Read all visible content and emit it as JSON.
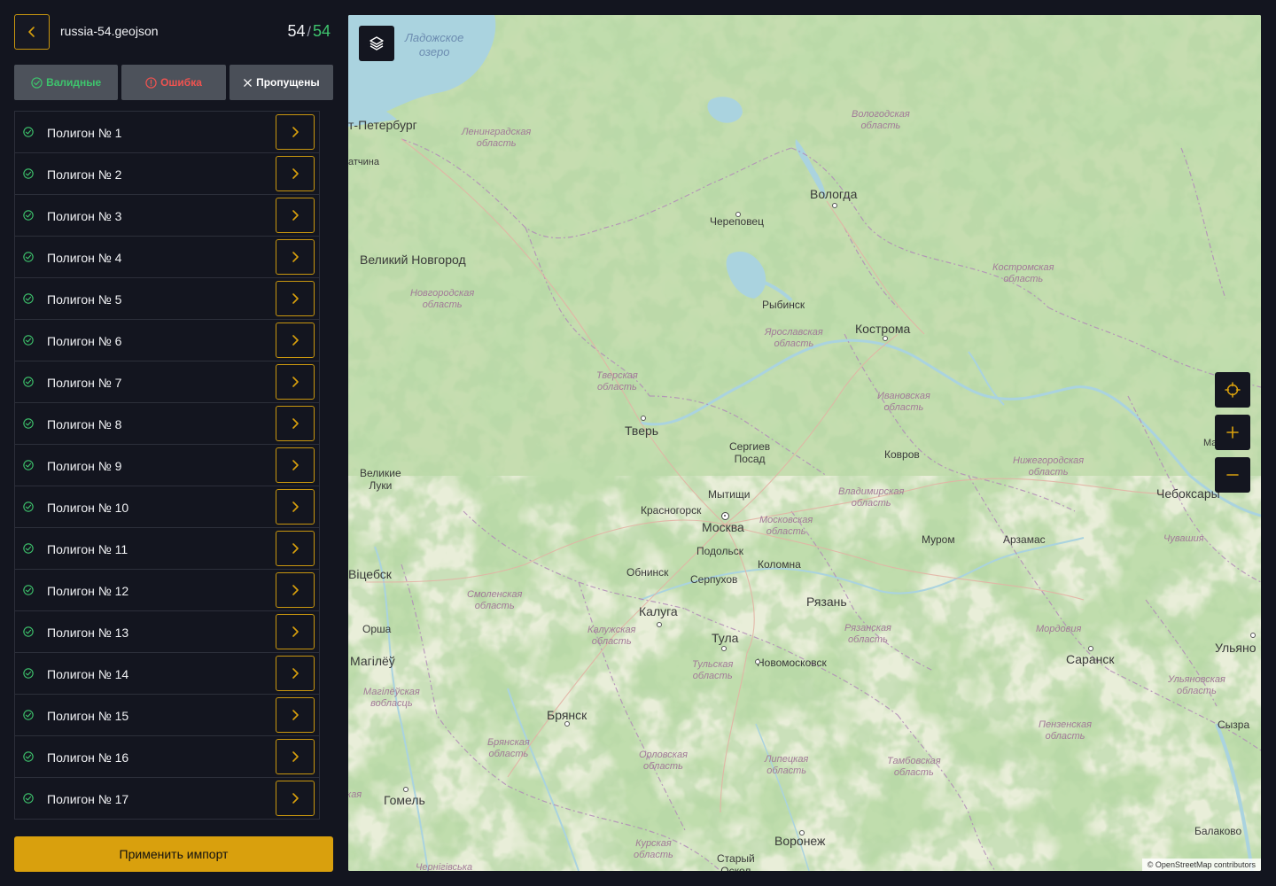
{
  "header": {
    "file_name": "russia-54.geojson",
    "count_current": "54",
    "count_separator": "/",
    "count_total": "54"
  },
  "filters": {
    "valid": "Валидные",
    "error": "Ошибка",
    "skipped": "Пропущены"
  },
  "polygons": [
    "Полигон № 1",
    "Полигон № 2",
    "Полигон № 3",
    "Полигон № 4",
    "Полигон № 5",
    "Полигон № 6",
    "Полигон № 7",
    "Полигон № 8",
    "Полигон № 9",
    "Полигон № 10",
    "Полигон № 11",
    "Полигон № 12",
    "Полигон № 13",
    "Полигон № 14",
    "Полигон № 15",
    "Полигон № 16",
    "Полигон № 17"
  ],
  "apply_label": "Применить импорт",
  "map": {
    "attribution": "© OpenStreetMap contributors",
    "lakes": {
      "ladoga": "Ладожское\nозеро"
    },
    "cities": {
      "spb": "т-Петербург",
      "gatchina": "атчина",
      "vologda": "Вологда",
      "cherepovets": "Череповец",
      "novgorod": "Великий Новгород",
      "rybinsk": "Рыбинск",
      "kostroma": "Кострома",
      "tver": "Тверь",
      "sergiev": "Сергиев\nПосад",
      "kovrov": "Ковров",
      "vluki": "Великие\nЛуки",
      "mytishchi": "Мытищи",
      "krasnogorsk": "Красногорск",
      "moscow": "Москва",
      "podolsk": "Подольск",
      "kolomna": "Коломна",
      "murom": "Муром",
      "arzamas": "Арзамас",
      "cheboksary": "Чебоксары",
      "vitebsk": "Віцебск",
      "obninsk": "Обнинск",
      "serpukhov": "Серпухов",
      "kaluga": "Калуга",
      "ryazan": "Рязань",
      "orsha": "Орша",
      "tula": "Тула",
      "novomoskovsk": "Новомосковск",
      "mogilev": "Магілёў",
      "saransk": "Саранск",
      "ulyanovsk": "Ульяно",
      "bryansk": "Брянск",
      "syzran": "Сызра",
      "gomel": "Гомель",
      "voronezh": "Воронеж",
      "balakovo": "Балаково",
      "staryi": "Старый\nОскол",
      "ma": "Ма"
    },
    "regions": {
      "leningrad": "Ленинградская\nобласть",
      "vologda": "Вологодская\nобласть",
      "kostroma": "Костромская\nобласть",
      "novgorod": "Новгородская\nобласть",
      "yaroslavl": "Ярославская\nобласть",
      "tver": "Тверская\nобласть",
      "ivanovo": "Ивановская\nобласть",
      "nizhny": "Нижегородская\nобласть",
      "vladimir": "Владимирская\nобласть",
      "moscow": "Московская\nобласть",
      "chuvash": "Чувашия",
      "smolensk": "Смоленская\nобласть",
      "kaluga": "Калужская\nобласть",
      "ryazan": "Рязанская\nобласть",
      "mordovia": "Мордовия",
      "tula": "Тульская\nобласть",
      "mogilev": "Магілёўская\nвобласць",
      "ulyanovsk": "Ульяновская\nобласть",
      "penza": "Пензенская\nобласть",
      "bryansk": "Брянская\nобласть",
      "orel": "Орловская\nобласть",
      "lipetsk": "Липецкая\nобласть",
      "tambov": "Тамбовская\nобласть",
      "kursk": "Курская\nобласть",
      "chernigov": "Чернігівська",
      "kr": "кая"
    }
  },
  "colors": {
    "accent": "#d9a00d",
    "valid": "#3ec46d",
    "error": "#ef5350",
    "panel_bg": "#13151f"
  },
  "icons": {
    "back": "chevron-left-icon",
    "valid": "check-circle-icon",
    "error": "alert-circle-icon",
    "skip": "x-icon",
    "row_arrow": "chevron-right-icon",
    "layers": "layers-icon",
    "locate": "crosshair-icon",
    "zoom_in": "plus-icon",
    "zoom_out": "minus-icon"
  }
}
